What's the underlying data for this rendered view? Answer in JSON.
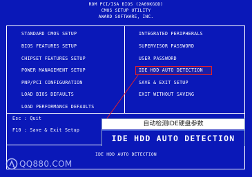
{
  "header": {
    "line1": "ROM PCI/ISA BIOS (2A69KGOD)",
    "line2": "CMOS SETUP UTILITY",
    "line3": "AWARD SOFTWARE, INC."
  },
  "menu": {
    "left": [
      "STANDARD CMOS SETUP",
      "BIOS FEATURES SETUP",
      "CHIPSET FEATURES SETUP",
      "POWER MANAGEMENT SETUP",
      "PNP/PCI CONFIGURATION",
      "LOAD BIOS DEFAULTS",
      "LOAD PERFORMANCE DEFAULTS"
    ],
    "right": [
      "INTEGRATED PERIPHERALS",
      "SUPERVISOR PASSWORD",
      "USER PASSWORD",
      "IDE HDD AUTO DETECTION",
      "SAVE & EXIT SETUP",
      "EXIT WITHOUT SAVING"
    ]
  },
  "keys": {
    "esc": "Esc : Quit",
    "f10": "F10 : Save & Exit Setup"
  },
  "status": "IDE HDD AUTO DETECTION",
  "callout": {
    "chinese": "自动检测IDE硬盘参数",
    "english": "IDE HDD AUTO DETECTION"
  },
  "watermark": "QQ880.COM",
  "colors": {
    "background": "#0a18b8",
    "text": "#ffffff",
    "highlight_border": "#e0202a"
  }
}
